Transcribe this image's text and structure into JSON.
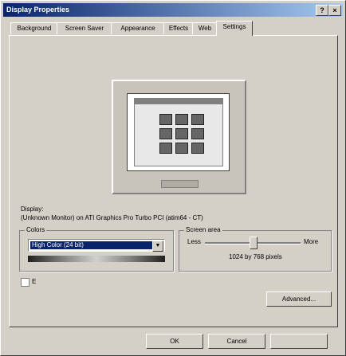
{
  "window": {
    "title": "Display Properties"
  },
  "titlebar": {
    "help_label": "?",
    "close_label": "×"
  },
  "tabs": [
    {
      "label": "Background"
    },
    {
      "label": "Screen Saver"
    },
    {
      "label": "Appearance"
    },
    {
      "label": "Effects"
    },
    {
      "label": "Web"
    },
    {
      "label": "Settings"
    }
  ],
  "active_tab": "Settings",
  "display": {
    "label": "Display:",
    "device": "(Unknown Monitor) on ATI Graphics Pro Turbo PCI (atim64 - CT)"
  },
  "colors": {
    "label": "Colors",
    "selected": "High Color (24 bit)"
  },
  "screen_area": {
    "label": "Screen area",
    "less_label": "Less",
    "more_label": "More",
    "value": "1024 by 768 pixels",
    "slider_position": 0.5
  },
  "extend_checkbox": {
    "label": "E",
    "checked": false
  },
  "buttons": {
    "advanced": "Advanced...",
    "ok": "OK",
    "cancel": "Cancel",
    "apply": ""
  }
}
